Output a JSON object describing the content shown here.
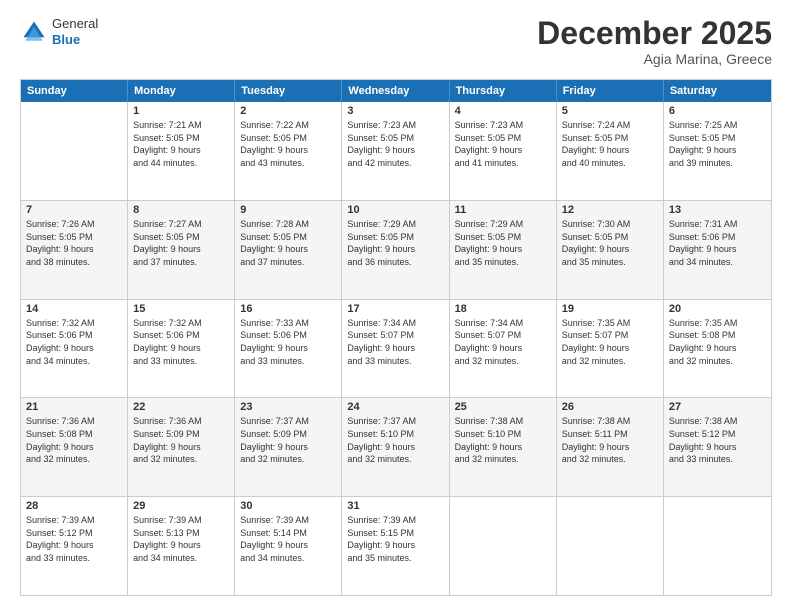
{
  "logo": {
    "general": "General",
    "blue": "Blue"
  },
  "title": "December 2025",
  "location": "Agia Marina, Greece",
  "days": [
    "Sunday",
    "Monday",
    "Tuesday",
    "Wednesday",
    "Thursday",
    "Friday",
    "Saturday"
  ],
  "weeks": [
    [
      {
        "num": "",
        "text": ""
      },
      {
        "num": "1",
        "text": "Sunrise: 7:21 AM\nSunset: 5:05 PM\nDaylight: 9 hours\nand 44 minutes."
      },
      {
        "num": "2",
        "text": "Sunrise: 7:22 AM\nSunset: 5:05 PM\nDaylight: 9 hours\nand 43 minutes."
      },
      {
        "num": "3",
        "text": "Sunrise: 7:23 AM\nSunset: 5:05 PM\nDaylight: 9 hours\nand 42 minutes."
      },
      {
        "num": "4",
        "text": "Sunrise: 7:23 AM\nSunset: 5:05 PM\nDaylight: 9 hours\nand 41 minutes."
      },
      {
        "num": "5",
        "text": "Sunrise: 7:24 AM\nSunset: 5:05 PM\nDaylight: 9 hours\nand 40 minutes."
      },
      {
        "num": "6",
        "text": "Sunrise: 7:25 AM\nSunset: 5:05 PM\nDaylight: 9 hours\nand 39 minutes."
      }
    ],
    [
      {
        "num": "7",
        "text": "Sunrise: 7:26 AM\nSunset: 5:05 PM\nDaylight: 9 hours\nand 38 minutes."
      },
      {
        "num": "8",
        "text": "Sunrise: 7:27 AM\nSunset: 5:05 PM\nDaylight: 9 hours\nand 37 minutes."
      },
      {
        "num": "9",
        "text": "Sunrise: 7:28 AM\nSunset: 5:05 PM\nDaylight: 9 hours\nand 37 minutes."
      },
      {
        "num": "10",
        "text": "Sunrise: 7:29 AM\nSunset: 5:05 PM\nDaylight: 9 hours\nand 36 minutes."
      },
      {
        "num": "11",
        "text": "Sunrise: 7:29 AM\nSunset: 5:05 PM\nDaylight: 9 hours\nand 35 minutes."
      },
      {
        "num": "12",
        "text": "Sunrise: 7:30 AM\nSunset: 5:05 PM\nDaylight: 9 hours\nand 35 minutes."
      },
      {
        "num": "13",
        "text": "Sunrise: 7:31 AM\nSunset: 5:06 PM\nDaylight: 9 hours\nand 34 minutes."
      }
    ],
    [
      {
        "num": "14",
        "text": "Sunrise: 7:32 AM\nSunset: 5:06 PM\nDaylight: 9 hours\nand 34 minutes."
      },
      {
        "num": "15",
        "text": "Sunrise: 7:32 AM\nSunset: 5:06 PM\nDaylight: 9 hours\nand 33 minutes."
      },
      {
        "num": "16",
        "text": "Sunrise: 7:33 AM\nSunset: 5:06 PM\nDaylight: 9 hours\nand 33 minutes."
      },
      {
        "num": "17",
        "text": "Sunrise: 7:34 AM\nSunset: 5:07 PM\nDaylight: 9 hours\nand 33 minutes."
      },
      {
        "num": "18",
        "text": "Sunrise: 7:34 AM\nSunset: 5:07 PM\nDaylight: 9 hours\nand 32 minutes."
      },
      {
        "num": "19",
        "text": "Sunrise: 7:35 AM\nSunset: 5:07 PM\nDaylight: 9 hours\nand 32 minutes."
      },
      {
        "num": "20",
        "text": "Sunrise: 7:35 AM\nSunset: 5:08 PM\nDaylight: 9 hours\nand 32 minutes."
      }
    ],
    [
      {
        "num": "21",
        "text": "Sunrise: 7:36 AM\nSunset: 5:08 PM\nDaylight: 9 hours\nand 32 minutes."
      },
      {
        "num": "22",
        "text": "Sunrise: 7:36 AM\nSunset: 5:09 PM\nDaylight: 9 hours\nand 32 minutes."
      },
      {
        "num": "23",
        "text": "Sunrise: 7:37 AM\nSunset: 5:09 PM\nDaylight: 9 hours\nand 32 minutes."
      },
      {
        "num": "24",
        "text": "Sunrise: 7:37 AM\nSunset: 5:10 PM\nDaylight: 9 hours\nand 32 minutes."
      },
      {
        "num": "25",
        "text": "Sunrise: 7:38 AM\nSunset: 5:10 PM\nDaylight: 9 hours\nand 32 minutes."
      },
      {
        "num": "26",
        "text": "Sunrise: 7:38 AM\nSunset: 5:11 PM\nDaylight: 9 hours\nand 32 minutes."
      },
      {
        "num": "27",
        "text": "Sunrise: 7:38 AM\nSunset: 5:12 PM\nDaylight: 9 hours\nand 33 minutes."
      }
    ],
    [
      {
        "num": "28",
        "text": "Sunrise: 7:39 AM\nSunset: 5:12 PM\nDaylight: 9 hours\nand 33 minutes."
      },
      {
        "num": "29",
        "text": "Sunrise: 7:39 AM\nSunset: 5:13 PM\nDaylight: 9 hours\nand 34 minutes."
      },
      {
        "num": "30",
        "text": "Sunrise: 7:39 AM\nSunset: 5:14 PM\nDaylight: 9 hours\nand 34 minutes."
      },
      {
        "num": "31",
        "text": "Sunrise: 7:39 AM\nSunset: 5:15 PM\nDaylight: 9 hours\nand 35 minutes."
      },
      {
        "num": "",
        "text": ""
      },
      {
        "num": "",
        "text": ""
      },
      {
        "num": "",
        "text": ""
      }
    ]
  ]
}
